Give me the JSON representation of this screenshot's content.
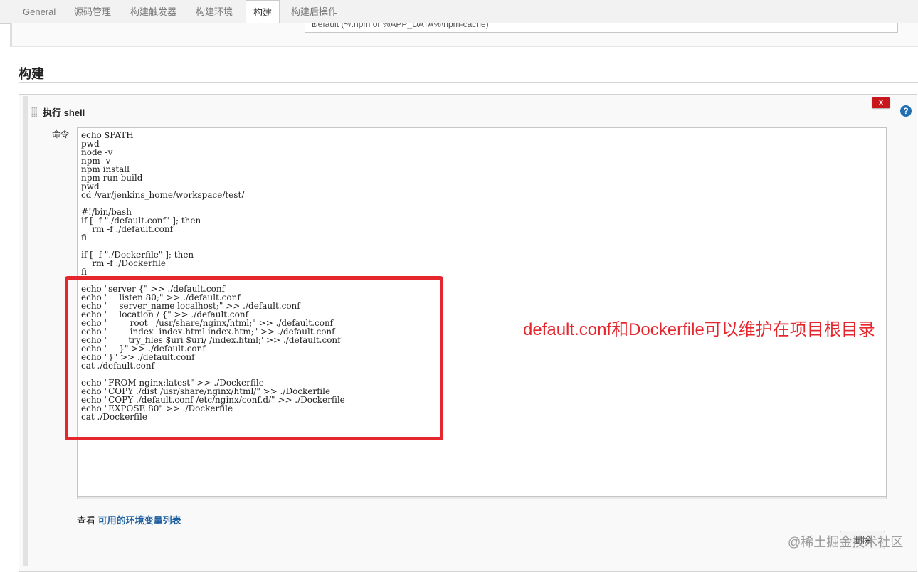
{
  "tabs": [
    {
      "label": "General"
    },
    {
      "label": "源码管理"
    },
    {
      "label": "构建触发器"
    },
    {
      "label": "构建环境"
    },
    {
      "label": "构建"
    },
    {
      "label": "构建后操作"
    }
  ],
  "npm_cache_select": {
    "value": "Default (~/.npm or %APP_DATA%\\npm-cache)"
  },
  "section": {
    "title": "构建"
  },
  "build_step": {
    "title": "执行 shell",
    "delete_icon_label": "x",
    "help_icon_label": "?",
    "command_label": "命令",
    "command": "echo $PATH\npwd\nnode -v\nnpm -v\nnpm install\nnpm run build\npwd\ncd /var/jenkins_home/workspace/test/\n\n#!/bin/bash\nif [ -f \"./default.conf\" ]; then\n    rm -f ./default.conf\nfi\n\nif [ -f \"./Dockerfile\" ]; then\n    rm -f ./Dockerfile\nfi\n\necho \"server {\" >> ./default.conf\necho \"    listen 80;\" >> ./default.conf\necho \"    server_name localhost;\" >> ./default.conf\necho \"    location / {\" >> ./default.conf\necho \"        root   /usr/share/nginx/html;\" >> ./default.conf\necho \"        index  index.html index.htm;\" >> ./default.conf\necho '        try_files $uri $uri/ /index.html;' >> ./default.conf\necho \"    }\" >> ./default.conf\necho \"}\" >> ./default.conf\ncat ./default.conf\n\necho \"FROM nginx:latest\" >> ./Dockerfile\necho \"COPY ./dist /usr/share/nginx/html/\" >> ./Dockerfile\necho \"COPY ./default.conf /etc/nginx/conf.d/\" >> ./Dockerfile\necho \"EXPOSE 80\" >> ./Dockerfile\ncat ./Dockerfile",
    "env_prefix": "查看 ",
    "env_link": "可用的环境变量列表",
    "delete_button": "删除"
  },
  "annotation": {
    "text": "default.conf和Dockerfile可以维护在项目根目录",
    "color": "#e5262d"
  },
  "watermark": "@稀土掘金技术社区"
}
